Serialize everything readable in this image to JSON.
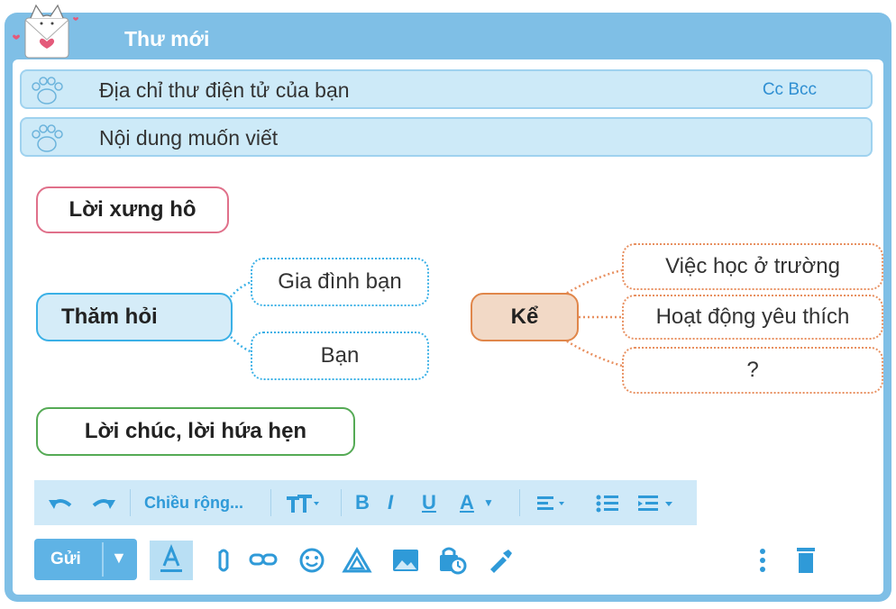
{
  "window": {
    "title": "Thư mới"
  },
  "to_field": {
    "placeholder": "Địa chỉ thư điện tử của bạn",
    "cc_bcc": "Cc Bcc"
  },
  "subject_field": {
    "placeholder": "Nội dung muốn viết"
  },
  "mindmap": {
    "greeting": "Lời xưng hô",
    "ask": "Thăm hỏi",
    "ask_items": [
      "Gia đình bạn",
      "Bạn"
    ],
    "tell": "Kể",
    "tell_items": [
      "Việc học ở trường",
      "Hoạt động yêu thích",
      "?"
    ],
    "closing": "Lời chúc, lời hứa hẹn"
  },
  "toolbar": {
    "undo_icon": "undo-icon",
    "redo_icon": "redo-icon",
    "font_label": "Chiều rộng...",
    "font_size_icon": "text-size-icon",
    "bold": "B",
    "italic": "I",
    "underline": "U",
    "text_color": "A",
    "align_icon": "align-icon",
    "list_icon": "bullet-list-icon",
    "indent_icon": "indent-icon"
  },
  "bottom_bar": {
    "send_label": "Gửi",
    "icons": [
      "formatting-icon",
      "attach-icon",
      "link-icon",
      "emoji-icon",
      "drive-icon",
      "image-icon",
      "confidential-icon",
      "signature-icon",
      "more-icon",
      "trash-icon"
    ]
  },
  "colors": {
    "frame": "#7fbfe6",
    "field": "#cdeaf8",
    "accent": "#2f9ad8"
  }
}
